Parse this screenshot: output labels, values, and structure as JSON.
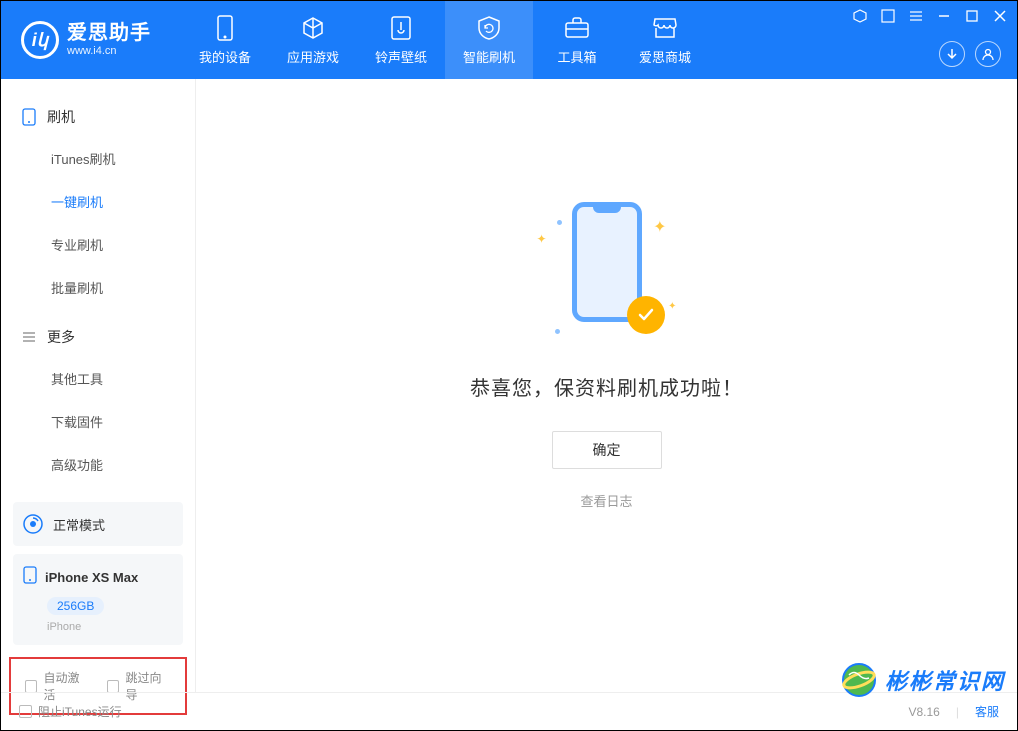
{
  "header": {
    "app_title": "爱思助手",
    "app_url": "www.i4.cn",
    "tabs": [
      {
        "label": "我的设备"
      },
      {
        "label": "应用游戏"
      },
      {
        "label": "铃声壁纸"
      },
      {
        "label": "智能刷机"
      },
      {
        "label": "工具箱"
      },
      {
        "label": "爱思商城"
      }
    ]
  },
  "sidebar": {
    "section_flash": {
      "title": "刷机",
      "items": [
        {
          "label": "iTunes刷机"
        },
        {
          "label": "一键刷机"
        },
        {
          "label": "专业刷机"
        },
        {
          "label": "批量刷机"
        }
      ]
    },
    "section_more": {
      "title": "更多",
      "items": [
        {
          "label": "其他工具"
        },
        {
          "label": "下载固件"
        },
        {
          "label": "高级功能"
        }
      ]
    },
    "status_text": "正常模式",
    "device": {
      "name": "iPhone XS Max",
      "storage": "256GB",
      "type": "iPhone"
    },
    "checks": {
      "auto_activate": "自动激活",
      "skip_guide": "跳过向导"
    }
  },
  "main": {
    "success_message": "恭喜您，保资料刷机成功啦！",
    "ok_button": "确定",
    "view_log": "查看日志"
  },
  "statusbar": {
    "block_itunes": "阻止iTunes运行",
    "version": "V8.16",
    "support": "客服"
  },
  "watermark": {
    "text": "彬彬常识网"
  }
}
